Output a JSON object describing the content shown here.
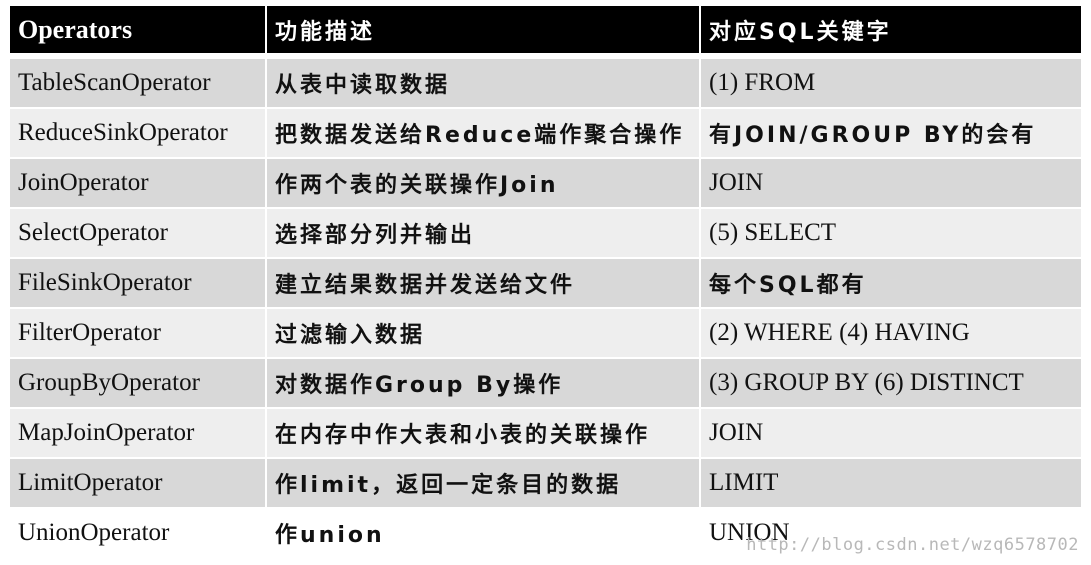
{
  "table": {
    "headers": [
      "Operators",
      "功能描述",
      "对应SQL关键字"
    ],
    "rows": [
      {
        "operator": "TableScanOperator",
        "description": "从表中读取数据",
        "sql": "(1) FROM"
      },
      {
        "operator": "ReduceSinkOperator",
        "description": "把数据发送给Reduce端作聚合操作",
        "sql": "有JOIN/GROUP BY的会有"
      },
      {
        "operator": "JoinOperator",
        "description": "作两个表的关联操作Join",
        "sql": "JOIN"
      },
      {
        "operator": "SelectOperator",
        "description": "选择部分列并输出",
        "sql": "(5) SELECT"
      },
      {
        "operator": "FileSinkOperator",
        "description": "建立结果数据并发送给文件",
        "sql": "每个SQL都有"
      },
      {
        "operator": "FilterOperator",
        "description": "过滤输入数据",
        "sql": "(2) WHERE (4) HAVING"
      },
      {
        "operator": "GroupByOperator",
        "description": "对数据作Group By操作",
        "sql": "(3) GROUP BY (6) DISTINCT"
      },
      {
        "operator": "MapJoinOperator",
        "description": "在内存中作大表和小表的关联操作",
        "sql": "JOIN"
      },
      {
        "operator": "LimitOperator",
        "description": "作limit，返回一定条目的数据",
        "sql": "LIMIT"
      },
      {
        "operator": "UnionOperator",
        "description": "作union",
        "sql": "UNION"
      }
    ]
  },
  "watermark": "http://blog.csdn.net/wzq6578702",
  "colors": {
    "header_bg": "#000000",
    "header_text": "#ffffff",
    "row_dark": "#d8d8d8",
    "row_light": "#eeeeee"
  }
}
